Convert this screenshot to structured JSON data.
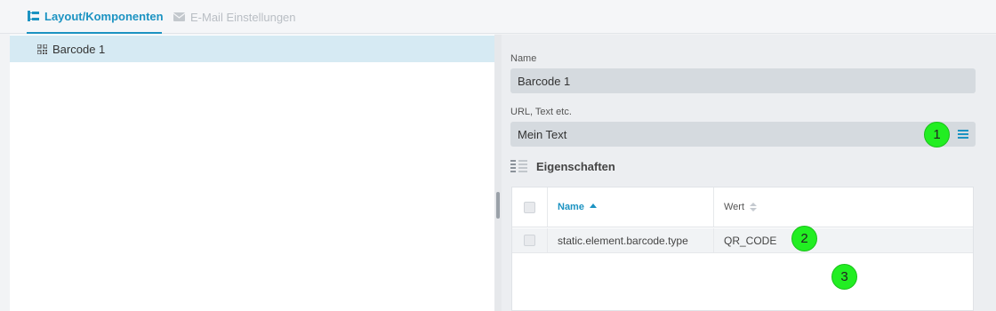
{
  "tabs": [
    {
      "label": "Layout/Komponenten",
      "active": true,
      "icon": "tree-layout-icon"
    },
    {
      "label": "E-Mail Einstellungen",
      "active": false,
      "icon": "envelope-icon"
    }
  ],
  "tree": {
    "items": [
      {
        "label": "Barcode 1",
        "icon": "qr-code-icon",
        "selected": true
      }
    ]
  },
  "form": {
    "name_label": "Name",
    "name_value": "Barcode 1",
    "url_label": "URL, Text etc.",
    "url_value": "Mein Text",
    "url_menu_icon": "hamburger-menu-icon"
  },
  "properties": {
    "title": "Eigenschaften",
    "icon": "properties-list-icon",
    "columns": [
      {
        "label": "Name",
        "sort": "ascending"
      },
      {
        "label": "Wert",
        "sort": "none"
      }
    ],
    "rows": [
      {
        "name": "static.element.barcode.type",
        "value": "QR_CODE"
      }
    ]
  },
  "markers": [
    "1",
    "2",
    "3"
  ],
  "colors": {
    "accent": "#1c93c2",
    "selected_row": "#d6eaf3",
    "field_bg": "#d5dadf",
    "marker_green": "#22ee22"
  }
}
